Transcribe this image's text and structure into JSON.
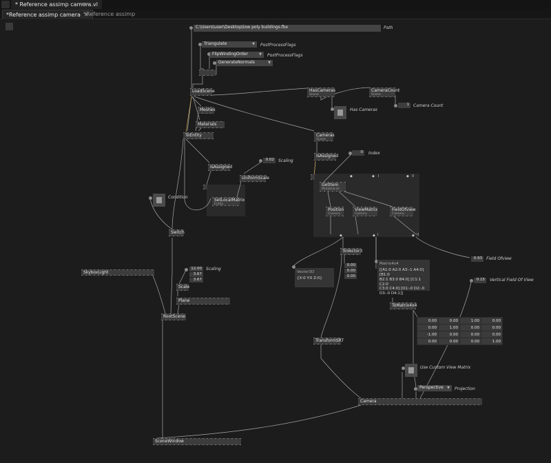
{
  "window": {
    "file_tab": "* Reference assimp camera.vl",
    "nav_arrows": "◀ ▶"
  },
  "tabs": [
    {
      "label": "*Reference assimp camera",
      "close": "✕"
    },
    {
      "label": "*Reference assimp"
    }
  ],
  "path": {
    "value": "C:\\Users\\user\\Desktop\\low poly buildings.fbx",
    "label": "Path"
  },
  "flags": {
    "triangulate": "Triangulate",
    "flip": "FlipWindingOrder",
    "normals": "GenerateNormals",
    "label": "PostProcessFlags"
  },
  "nodes": {
    "loadscene": "LoadScene",
    "hascameras": "HasCameras",
    "hascameras_sub": "Scene",
    "cameracount": "CameraCount",
    "cameracount_sub": "Scene",
    "meshes": "Meshes",
    "materials": "Materials",
    "toentity": "ToEntity",
    "cameras": "Cameras",
    "cameras_sub": "Scene",
    "isassigned1": "IsAssigned",
    "isassigned2": "IsAssigned",
    "uniformscale": "UniformScale",
    "setlocalmatrix": "SetLocalMatrix",
    "setlocalmatrix_sub": "Entity",
    "getitem": "GetItem",
    "getitem_sub": "MutableList",
    "position": "Position",
    "position_sub": "Camera",
    "viewmatrix": "ViewMatrix",
    "viewmatrix_sub": "Camera",
    "fieldofview": "FieldOfview",
    "fieldofview_sub": "Camera",
    "switch": "Switch",
    "skyboxlight": "SkyboxLight",
    "scale": "Scale",
    "plane": "Plane",
    "rootscene": "RootScene",
    "tovector3": "ToVector3",
    "transformsrt": "TransformSRT",
    "tomatrix": "ToMatrix4x4",
    "camera": "Camera",
    "scenewindow": "SceneWindow"
  },
  "values": {
    "camera_count": "1",
    "camera_count_label": "Camera Count",
    "has_cameras_label": "Has Cameras",
    "index": "0",
    "index_label": "Index",
    "scaling": "0.02",
    "scaling_label": "Scaling",
    "condition_label": "Condition",
    "scale_x": "12.00",
    "scale_y": "3.67",
    "scale_z": "3.67",
    "scaling2_label": "Scaling",
    "vec_x": "0.00",
    "vec_y": "0.00",
    "vec_z": "0.00",
    "fov": "0.93",
    "fov_label": "Field Ofview",
    "vfov": "0.15",
    "vfov_label": "Vertical Field Of View",
    "custom_view_label": "Use Custom View Matrix",
    "projection": "Perspective",
    "projection_label": "Projection",
    "io_1": "I",
    "io_2": "II"
  },
  "tooltips": {
    "vector_title": "Vector3D",
    "vector_value": "{X:0 Y:0 Z:0}",
    "matrix_title": "Matrix4x4",
    "matrix_l1": "[[A1:0 A2:0 A3:-1 A4:0] [B1:0",
    "matrix_l2": "B2:1 B3:0 B4:0] [C1:1 C2:0",
    "matrix_l3": "C3:0 C4:0] [D1:-0 D2:-0",
    "matrix_l4": "D3:-0 D4:1]]"
  },
  "matrix": [
    [
      "0.00",
      "0.00",
      "1.00",
      "0.00"
    ],
    [
      "0.00",
      "1.00",
      "0.00",
      "0.00"
    ],
    [
      "-1.00",
      "0.00",
      "0.00",
      "0.00"
    ],
    [
      "0.00",
      "0.00",
      "0.00",
      "1.00"
    ]
  ]
}
